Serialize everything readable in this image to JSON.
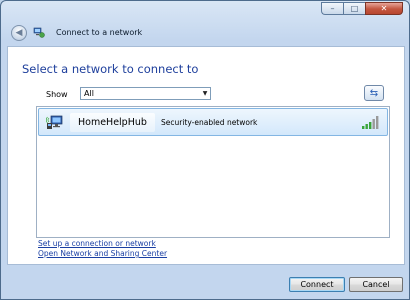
{
  "window": {
    "title": "Connect to a network",
    "controls": {
      "minimize": "–",
      "maximize": "□",
      "close": "✕"
    }
  },
  "main": {
    "heading": "Select a network to connect to",
    "show_label": "Show",
    "show_value": "All",
    "refresh_icon": "refresh-icon"
  },
  "networks": [
    {
      "name": "HomeHelpHub",
      "description": "Security-enabled network",
      "signal_bars": 5,
      "selected": true
    }
  ],
  "links": {
    "setup": "Set up a connection or network",
    "sharing_center": "Open Network and Sharing Center"
  },
  "buttons": {
    "connect": "Connect",
    "cancel": "Cancel"
  },
  "colors": {
    "heading": "#1e3f9c",
    "link": "#1a3fa3",
    "selection": "#d3e8fb"
  }
}
